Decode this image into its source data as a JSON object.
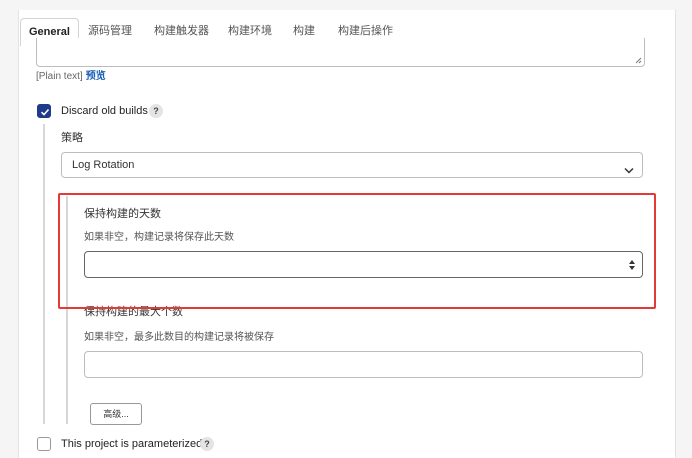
{
  "tabs": [
    {
      "label": "General",
      "active": true
    },
    {
      "label": "源码管理"
    },
    {
      "label": "构建触发器"
    },
    {
      "label": "构建环境"
    },
    {
      "label": "构建"
    },
    {
      "label": "构建后操作"
    }
  ],
  "description": {
    "plain_text": "[Plain text]",
    "preview": "预览"
  },
  "discard_old_builds": {
    "label": "Discard old builds",
    "checked": true,
    "help": "?"
  },
  "strategy": {
    "label": "策略",
    "selected": "Log Rotation"
  },
  "days_to_keep": {
    "label": "保持构建的天数",
    "description": "如果非空，构建记录将保存此天数",
    "value": ""
  },
  "max_builds": {
    "label": "保持构建的最大个数",
    "description": "如果非空，最多此数目的构建记录将被保存",
    "value": ""
  },
  "advanced_button": "高级...",
  "parameterized": {
    "label": "This project is parameterized",
    "checked": false,
    "help": "?"
  },
  "colors": {
    "checkbox_checked": "#1e3a8a",
    "highlight_border": "#e53935",
    "link": "#1a5fb4"
  }
}
